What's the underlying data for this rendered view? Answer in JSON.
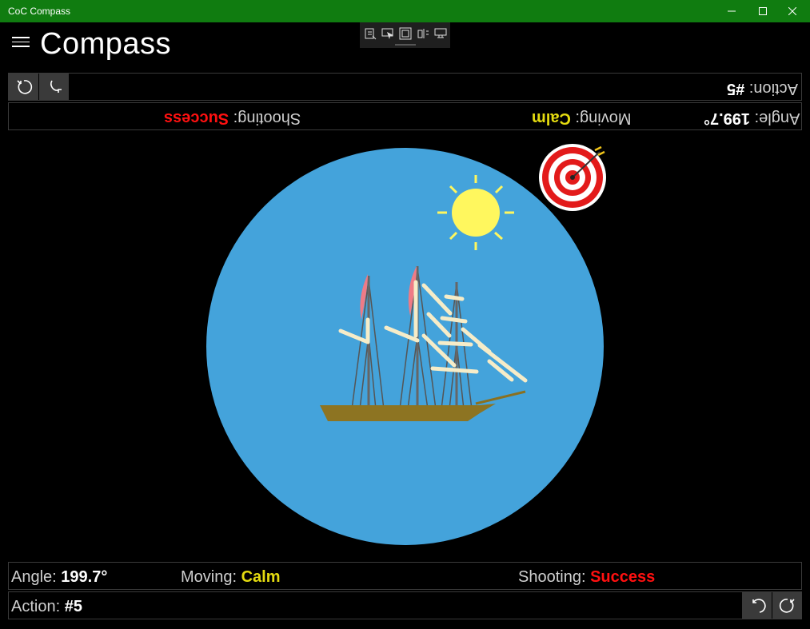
{
  "window": {
    "title": "CoC Compass"
  },
  "header": {
    "title": "Compass"
  },
  "status": {
    "angle_label": "Angle:",
    "angle_value": "199.7°",
    "moving_label": "Moving:",
    "moving_value": "Calm",
    "shooting_label": "Shooting:",
    "shooting_value": "Success",
    "action_label": "Action:",
    "action_value": "#5"
  },
  "colors": {
    "titlebar": "#107c10",
    "compass": "#44a3db",
    "calm": "#e4db10",
    "success": "#ff1010",
    "sun": "#fff75e"
  },
  "icons": {
    "undo": "undo-icon",
    "redo": "redo-icon",
    "sun": "sun-icon",
    "target": "target-icon",
    "ship": "ship-icon"
  }
}
